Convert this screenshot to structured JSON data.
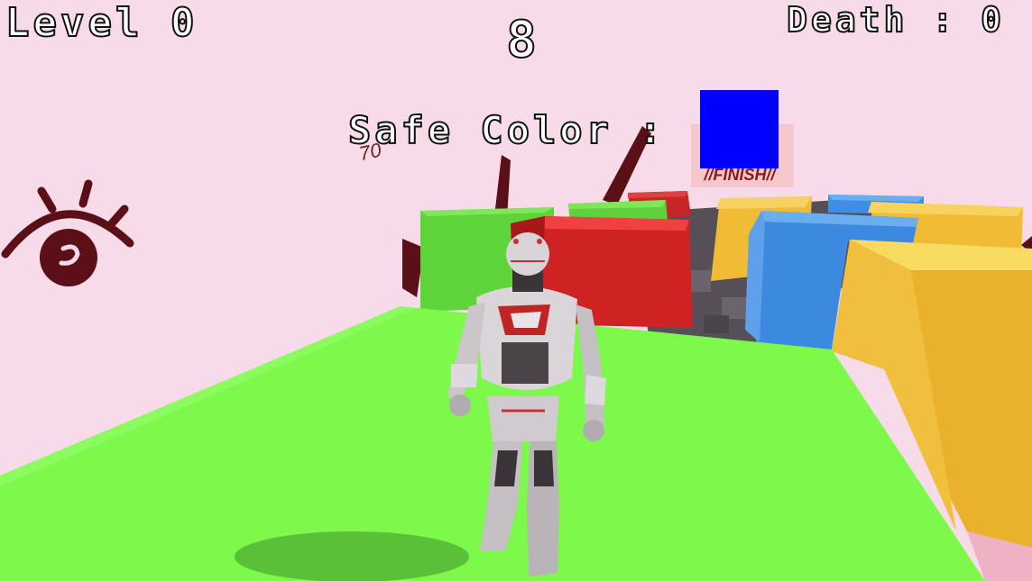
{
  "hud": {
    "level": "Level 0",
    "timer": "8",
    "death": "Death : 0",
    "safe_color_label": "Safe Color :",
    "safe_color": "#0000ff"
  },
  "scene": {
    "finish_sign": "//FINISH//",
    "scribble": "70",
    "colors": {
      "sky": "#f7dbe9",
      "floor": "#7cf94a",
      "green_block": "#6fe24a",
      "red_block": "#d82828",
      "blue_block": "#3d8fe6",
      "yellow_block": "#f0bc35",
      "ink": "#5b0f17"
    },
    "icons": [
      "eye-icon",
      "player-robot-character"
    ]
  }
}
